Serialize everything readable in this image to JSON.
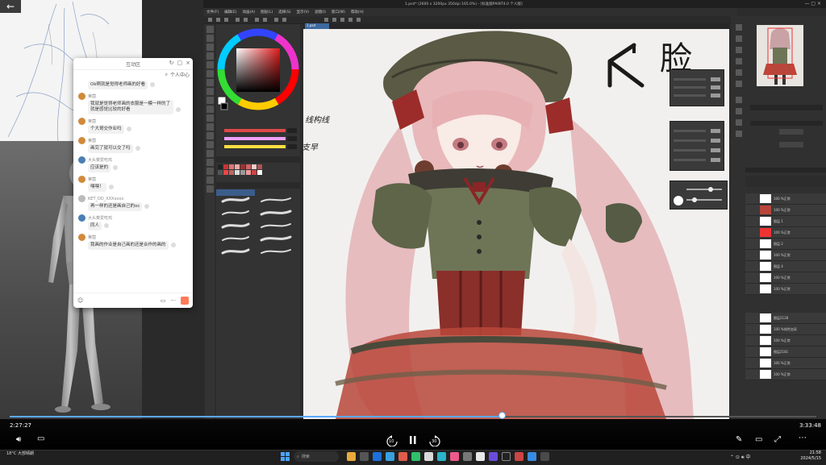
{
  "app": {
    "title": "1.psd* (2600 x 3200px 350dpi 165.0%) - [标准版PAINT4.0 个人版]",
    "menu": [
      "文件(F)",
      "编辑(E)",
      "动画(A)",
      "图层(L)",
      "选择(S)",
      "显示(V)",
      "滤镜(I)",
      "窗口(W)",
      "帮助(H)"
    ],
    "canvas_tab": "1.psd"
  },
  "chat": {
    "header_title": "互动区",
    "header_sub": "个人中心",
    "messages": [
      {
        "user": "",
        "text": "Ok啊就是觉得老师画的好看",
        "color": "#d08a3a"
      },
      {
        "user": "莱茵",
        "text": "我就是觉得老师画的衣服是一模一样的了就是感觉比较的好看",
        "color": "#d08a3a"
      },
      {
        "user": "莱茵",
        "text": "个大哥交作业吗",
        "color": "#d08a3a"
      },
      {
        "user": "莱茵",
        "text": "画完了就可以交了吗",
        "color": "#d08a3a"
      },
      {
        "user": "大头菜爱吃鸡",
        "text": "应该是的",
        "color": "#4a7fb5"
      },
      {
        "user": "莱茵",
        "text": "嘿嘿！",
        "color": "#d08a3a"
      },
      {
        "user": "KET_DD_XXXxxxx",
        "text": "再一样的还是画自己的oc",
        "color": "#bbbbbb"
      },
      {
        "user": "大头菜爱吃鸡",
        "text": "同人",
        "color": "#4a7fb5"
      },
      {
        "user": "莱茵",
        "text": "我画的作业是自己画的还是合作的画的",
        "color": "#d08a3a"
      }
    ],
    "footer_more": "···"
  },
  "video": {
    "time_current": "2:27:27",
    "time_total": "3:33:48",
    "progress": 0.61,
    "rewind_label": "10",
    "forward_label": "30"
  },
  "canvas_text": {
    "handwriting": "脸",
    "side_note": "线构线",
    "side_note2": "支早"
  },
  "layers": [
    "100 %正常",
    "100 %正常",
    "图层 1",
    "100 %正常",
    "图层 2",
    "100 %正常",
    "图层 4",
    "100 %正常",
    "100 %正常",
    "图层2128",
    "100 %线性加深",
    "100 %正常",
    "图层2181",
    "100 %正常",
    "100 %正常"
  ],
  "taskbar": {
    "search_placeholder": "搜索",
    "weather": "18°C 大部晴朗",
    "clock_time": "21:58",
    "clock_date": "2024/5/15"
  },
  "colors": {
    "accent": "#5aa9ff",
    "canvas_bg": "#f2f0ee",
    "chat_bg": "#ffffff"
  }
}
